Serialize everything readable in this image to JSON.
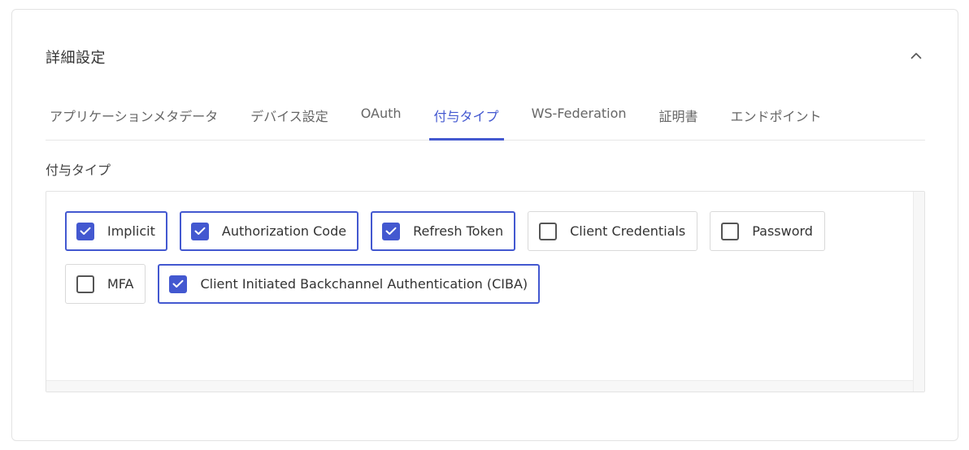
{
  "card": {
    "title": "詳細設定"
  },
  "tabs": [
    {
      "label": "アプリケーションメタデータ",
      "active": false
    },
    {
      "label": "デバイス設定",
      "active": false
    },
    {
      "label": "OAuth",
      "active": false
    },
    {
      "label": "付与タイプ",
      "active": true
    },
    {
      "label": "WS-Federation",
      "active": false
    },
    {
      "label": "証明書",
      "active": false
    },
    {
      "label": "エンドポイント",
      "active": false
    }
  ],
  "grant_types": {
    "label": "付与タイプ",
    "options": [
      {
        "label": "Implicit",
        "checked": true
      },
      {
        "label": "Authorization Code",
        "checked": true
      },
      {
        "label": "Refresh Token",
        "checked": true
      },
      {
        "label": "Client Credentials",
        "checked": false
      },
      {
        "label": "Password",
        "checked": false
      },
      {
        "label": "MFA",
        "checked": false
      },
      {
        "label": "Client Initiated Backchannel Authentication (CIBA)",
        "checked": true
      }
    ]
  },
  "colors": {
    "accent": "#4358d0"
  },
  "icons": {
    "collapse": "chevron-up-icon",
    "check": "check-icon"
  }
}
